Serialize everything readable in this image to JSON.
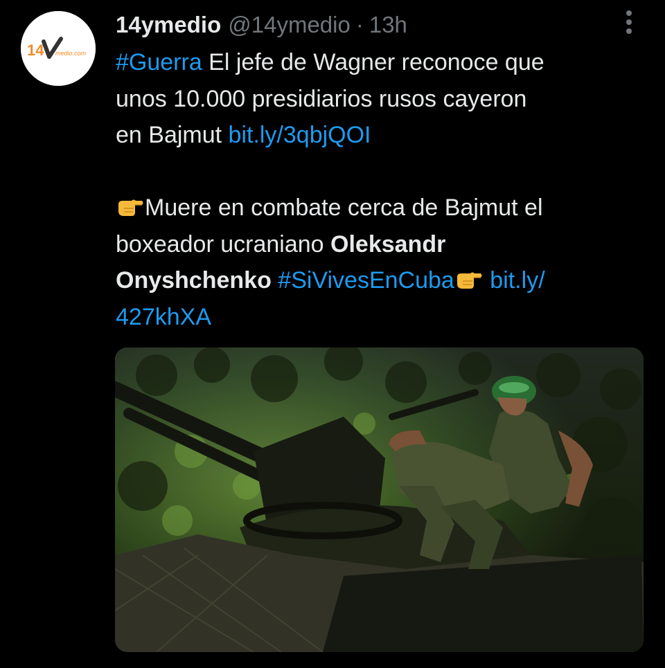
{
  "tweet": {
    "avatar": {
      "logo_text": "14",
      "logo_sub": "medio.com",
      "brand_color": "#f28c28"
    },
    "display_name": "14ymedio",
    "handle": "@14ymedio",
    "separator": "·",
    "time": "13h",
    "more_icon": "more-horizontal-icon",
    "text": {
      "hashtag_guerra": "#Guerra",
      "line1_rest": " El jefe de Wagner reconoce que",
      "line2": "unos 10.000 presidiarios rusos cayeron",
      "line3_start": "en Bajmut ",
      "link1": "bit.ly/3qbjQOI",
      "line4_emoji": "pointing-hand-emoji",
      "line4_rest": "Muere en combate cerca de Bajmut el",
      "line5_start": "boxeador ucraniano ",
      "line5_bold": "Oleksandr",
      "line6_bold": "Onyshchenko",
      "line6_space": " ",
      "hashtag_sivives": "#SiVivesEnCuba",
      "line6_emoji": "pointing-hand-emoji",
      "link2_part1": " bit.ly/",
      "link2_part2": "427khXA"
    },
    "media": {
      "kind": "photo",
      "subject": "soldier-on-anti-aircraft-gun"
    }
  },
  "colors": {
    "background": "#000000",
    "text": "#e7e9ea",
    "secondary": "#71767b",
    "link": "#1d9bf0"
  }
}
